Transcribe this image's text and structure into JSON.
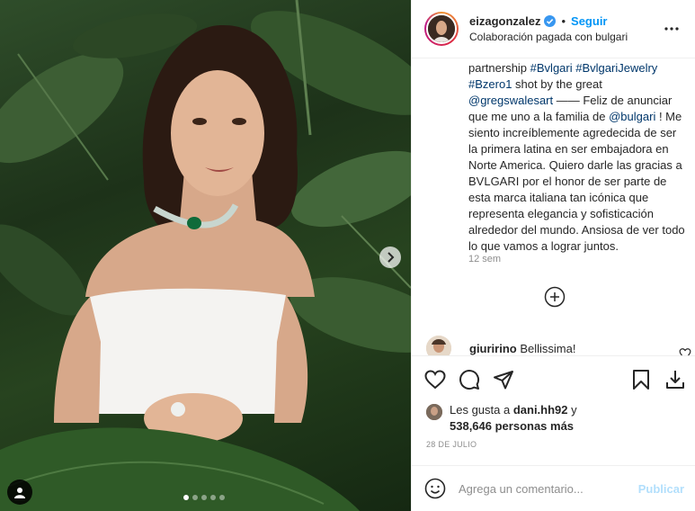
{
  "photo": {
    "carousel_slides": 5,
    "active_slide": 1,
    "icons": {
      "next": "chevron-right-icon",
      "tags": "user-tag-icon"
    }
  },
  "header": {
    "username": "eizagonzalez",
    "separator": "•",
    "follow_label": "Seguir",
    "partnership": "Colaboración pagada con bulgari",
    "verified_icon": "verified-badge-icon",
    "more_icon": "more-options-icon"
  },
  "caption": {
    "part1": "partnership ",
    "tag1": "#Bvlgari",
    "space1": " ",
    "tag2": "#BvlgariJewelry",
    "space2": " ",
    "tag3": "#Bzero1",
    "part2": " shot by the great ",
    "mention1": "@gregswalesart",
    "part3": " —— Feliz de anunciar que me uno a la familia de ",
    "mention2": "@bulgari",
    "part4": " ! Me siento increíblemente agredecida de ser la primera latina en ser embajadora en Norte America. Quiero darle las gracias a BVLGARI por el honor de ser parte de esta marca italiana tan icónica que representa elegancia y sofisticación alrededor del mundo. Ansiosa de ver todo lo que vamos a lograr juntos.",
    "time": "12 sem"
  },
  "comments": [
    {
      "user": "giuririno",
      "text": "Bellissima!"
    }
  ],
  "actions": {
    "like_icon": "heart-icon",
    "comment_icon": "comment-icon",
    "share_icon": "send-icon",
    "save_icon": "bookmark-icon",
    "download_icon": "download-icon"
  },
  "likes": {
    "prefix": "Les gusta a ",
    "user": "dani.hh92",
    "middle": " y",
    "count": "538,646 personas más"
  },
  "date": "28 DE JULIO",
  "add_comment": {
    "placeholder": "Agrega un comentario...",
    "publish_label": "Publicar",
    "emoji_icon": "emoji-icon"
  },
  "colors": {
    "accent": "#0095f6",
    "link": "#00376b",
    "muted": "#8e8e8e",
    "publish_disabled": "#b2dffc"
  }
}
